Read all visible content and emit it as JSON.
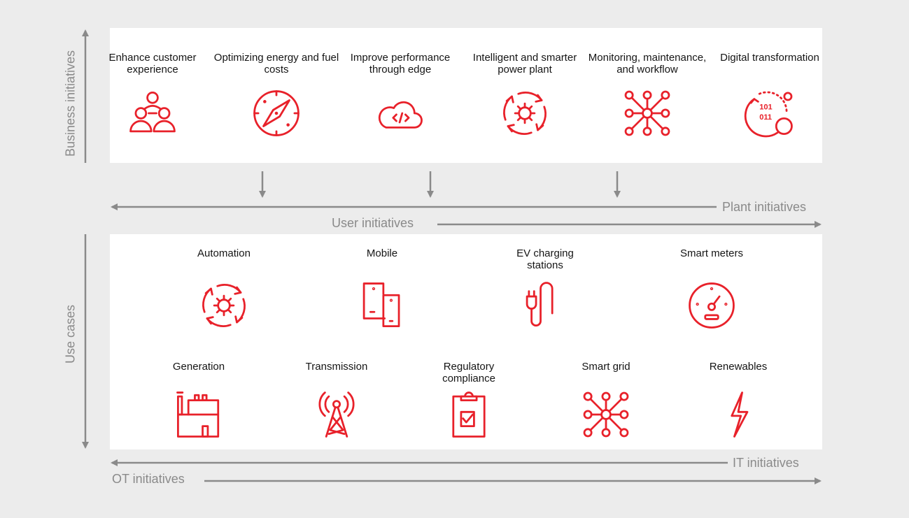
{
  "colors": {
    "accent": "#e8212a",
    "arrow": "#8a8a8a",
    "background": "#ececec",
    "panel": "#ffffff"
  },
  "axes": {
    "business_initiatives": "Business initiatives",
    "use_cases": "Use cases",
    "plant_initiatives": "Plant initiatives",
    "user_initiatives": "User initiatives",
    "it_initiatives": "IT initiatives",
    "ot_initiatives": "OT initiatives"
  },
  "business": [
    {
      "title": "Enhance customer experience",
      "icon": "people-group"
    },
    {
      "title": "Optimizing energy and fuel costs",
      "icon": "compass"
    },
    {
      "title": "Improve performance through edge",
      "icon": "cloud-code"
    },
    {
      "title": "Intelligent and smarter power plant",
      "icon": "gear-cycle"
    },
    {
      "title": "Monitoring, maintenance, and workflow",
      "icon": "hub-network"
    },
    {
      "title": "Digital transformation",
      "icon": "digital-transform"
    }
  ],
  "use_cases_row1": [
    {
      "title": "Automation",
      "icon": "gear-cycle"
    },
    {
      "title": "Mobile",
      "icon": "mobile-devices"
    },
    {
      "title": "EV charging stations",
      "icon": "ev-plug"
    },
    {
      "title": "Smart meters",
      "icon": "gauge"
    }
  ],
  "use_cases_row2": [
    {
      "title": "Generation",
      "icon": "factory"
    },
    {
      "title": "Transmission",
      "icon": "tower"
    },
    {
      "title": "Regulatory compliance",
      "icon": "clipboard-check"
    },
    {
      "title": "Smart grid",
      "icon": "hub-network"
    },
    {
      "title": "Renewables",
      "icon": "lightning"
    }
  ]
}
